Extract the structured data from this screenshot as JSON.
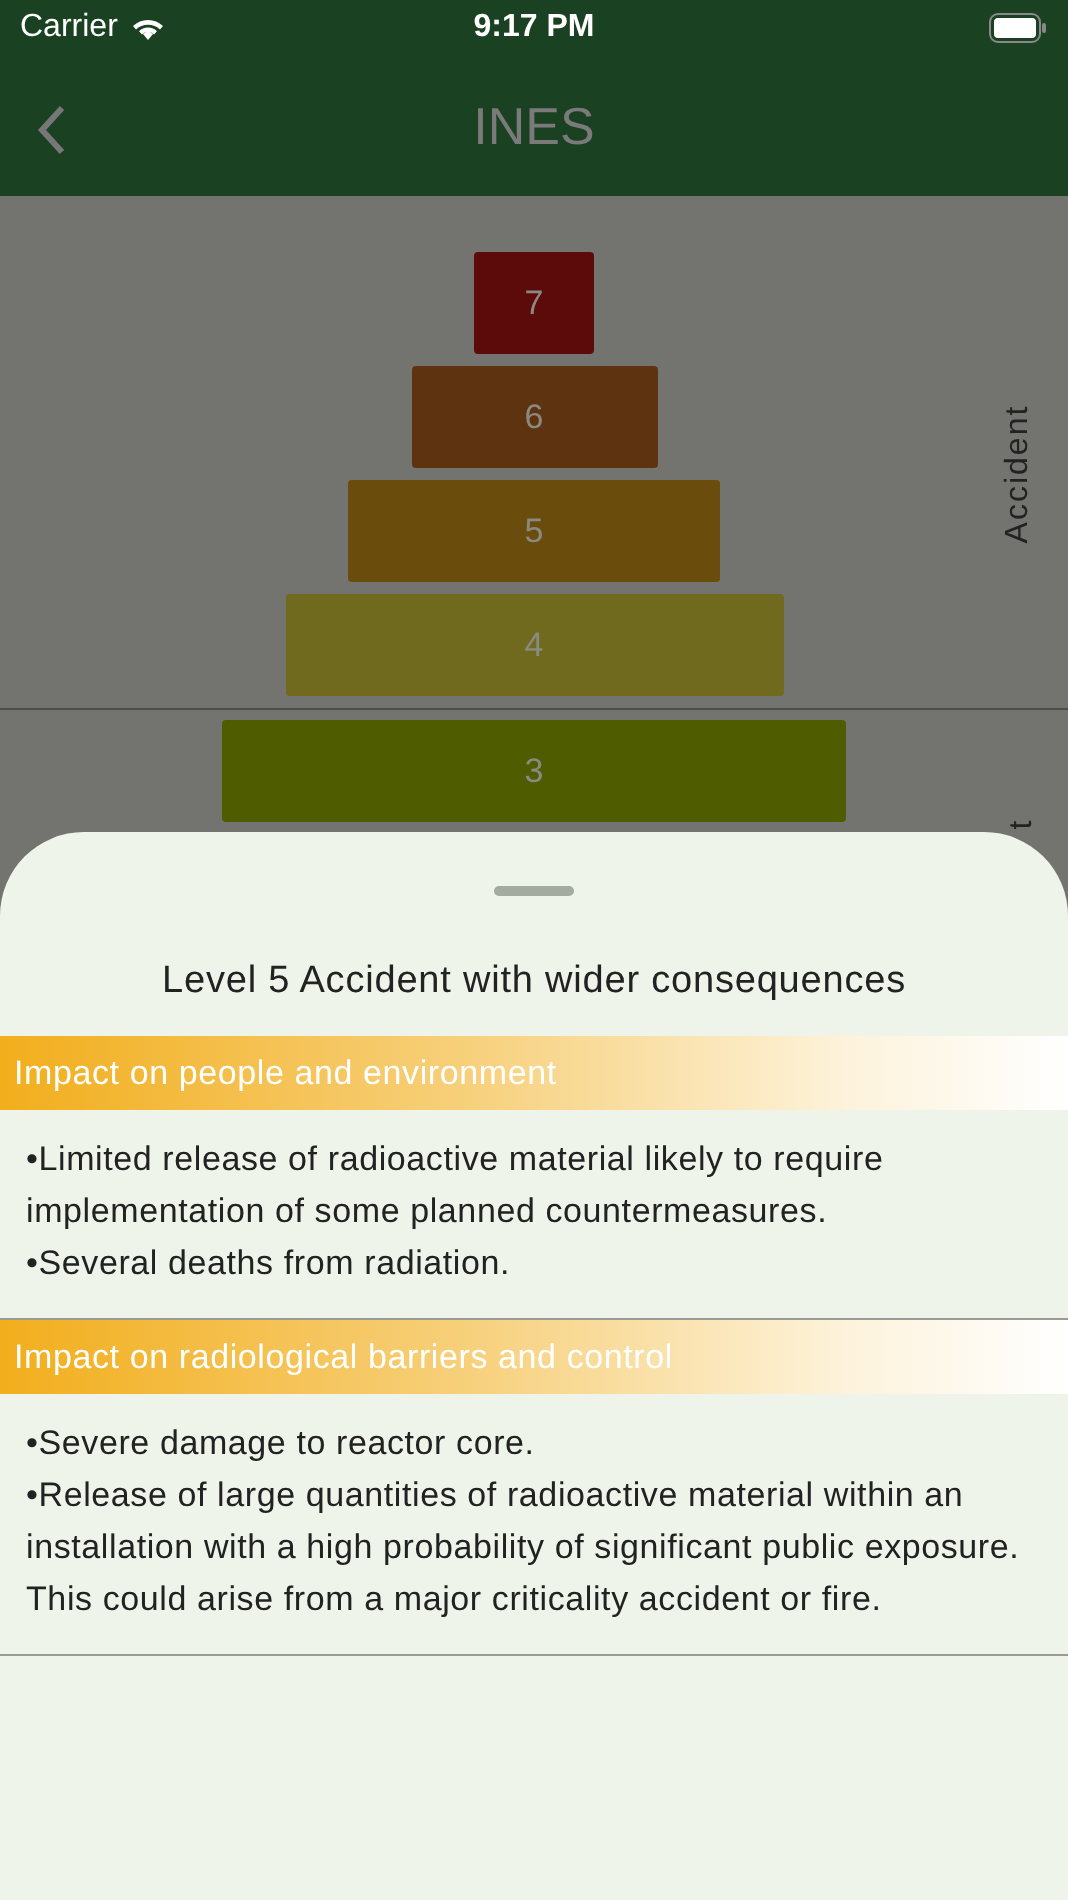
{
  "status_bar": {
    "carrier": "Carrier",
    "time": "9:17 PM"
  },
  "nav": {
    "title": "INES"
  },
  "pyramid": {
    "levels": [
      {
        "label": "7",
        "color": "#5c0b0a"
      },
      {
        "label": "6",
        "color": "#5e3310"
      },
      {
        "label": "5",
        "color": "#6a4d0c"
      },
      {
        "label": "4",
        "color": "#6f6a1e"
      },
      {
        "label": "3",
        "color": "#505c00"
      }
    ],
    "side_labels": [
      "Accident",
      "t"
    ]
  },
  "sheet": {
    "title": "Level 5 Accident with wider consequences",
    "sections": [
      {
        "header": "Impact on people and environment",
        "lines": [
          "•Limited release of radioactive material likely to require implementation of some planned countermeasures.",
          "•Several deaths from radiation."
        ]
      },
      {
        "header": "Impact on radiological barriers and control",
        "lines": [
          "•Severe damage to reactor core.",
          "•Release of large quantities of radioactive material within an installation with a high probability of significant public exposure. This could arise from a major criticality accident or fire."
        ]
      }
    ]
  }
}
